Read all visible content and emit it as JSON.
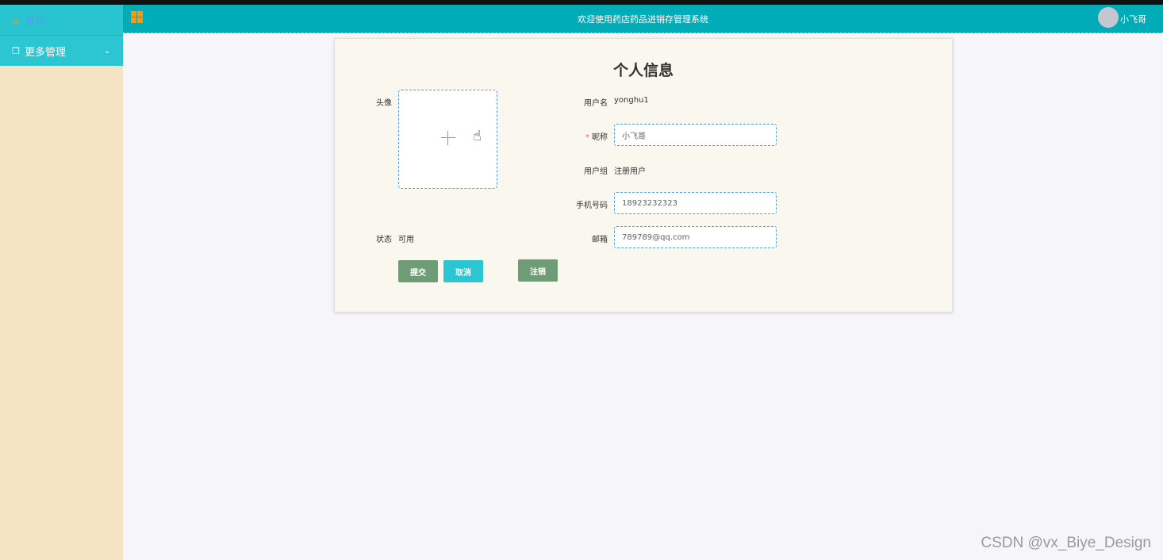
{
  "sidebar": {
    "items": [
      {
        "label": "首页",
        "icon": "home-icon"
      },
      {
        "label": "更多管理",
        "icon": "copy-icon"
      }
    ]
  },
  "header": {
    "title": "欢迎使用药店药品进销存管理系统",
    "user_name": "小飞哥"
  },
  "form": {
    "title": "个人信息",
    "avatar_label": "头像",
    "status_label": "状态",
    "status_value": "可用",
    "username_label": "用户名",
    "username_value": "yonghu1",
    "nickname_label": "昵称",
    "nickname_required_mark": "*",
    "nickname_value": "小飞哥",
    "group_label": "用户组",
    "group_value": "注册用户",
    "phone_label": "手机号码",
    "phone_value": "18923232323",
    "email_label": "邮箱",
    "email_value": "789789@qq.com"
  },
  "buttons": {
    "submit": "提交",
    "cancel": "取消",
    "logout": "注销"
  },
  "watermark": "CSDN @vx_Biye_Design",
  "colors": {
    "header": "#00acb7",
    "sidebar": "#f5e4c3",
    "sidebar_item": "#28c4cf",
    "button_green": "#6e9c74",
    "button_teal": "#2bc6d2",
    "accent_icon": "#f29a13"
  }
}
